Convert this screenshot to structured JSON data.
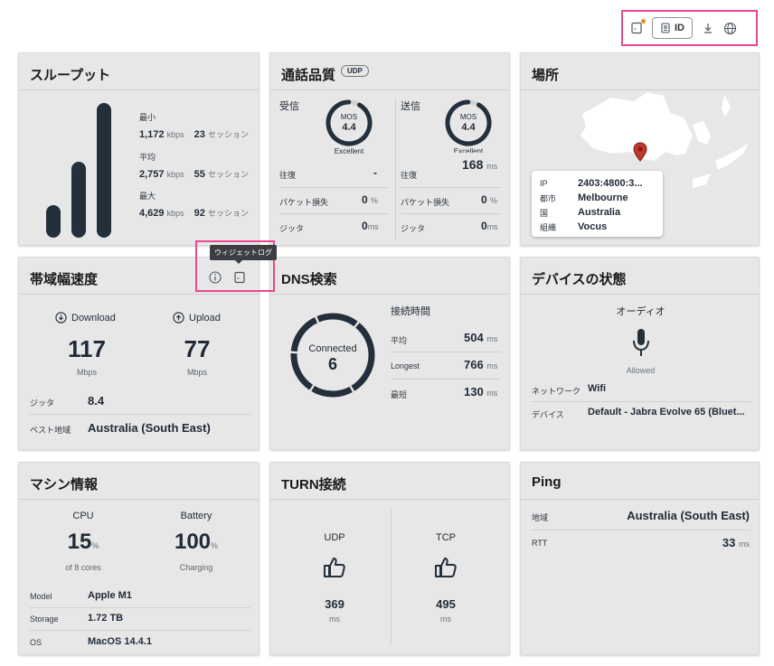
{
  "toolbar": {
    "id_label": "ID"
  },
  "throughput": {
    "title": "スループット",
    "bars": [
      0.23,
      0.53,
      0.94
    ],
    "rows": [
      {
        "label": "最小",
        "value": "1,172",
        "unit": "kbps",
        "sessions": "23",
        "sessions_unit": "セッション"
      },
      {
        "label": "平均",
        "value": "2,757",
        "unit": "kbps",
        "sessions": "55",
        "sessions_unit": "セッション"
      },
      {
        "label": "最大",
        "value": "4,629",
        "unit": "kbps",
        "sessions": "92",
        "sessions_unit": "セッション"
      }
    ]
  },
  "call_quality": {
    "title": "通話品質",
    "badge": "UDP",
    "receive": {
      "label": "受信",
      "mos_label": "MOS",
      "mos": "4.4",
      "rating": "Excellent",
      "return_label": "往復",
      "return_value": "-",
      "loss_label": "パケット損失",
      "loss_value": "0",
      "loss_unit": "%",
      "jitter_label": "ジッタ",
      "jitter_value": "0",
      "jitter_unit": "ms"
    },
    "send": {
      "label": "送信",
      "mos_label": "MOS",
      "mos": "4.4",
      "rating": "Excellent",
      "return_label": "往復",
      "return_value": "168",
      "return_unit": "ms",
      "loss_label": "パケット損失",
      "loss_value": "0",
      "loss_unit": "%",
      "jitter_label": "ジッタ",
      "jitter_value": "0",
      "jitter_unit": "ms"
    }
  },
  "location": {
    "title": "場所",
    "rows": [
      {
        "label": "IP",
        "value": "2403:4800:3..."
      },
      {
        "label": "都市",
        "value": "Melbourne"
      },
      {
        "label": "国",
        "value": "Australia"
      },
      {
        "label": "組織",
        "value": "Vocus"
      }
    ]
  },
  "bandwidth": {
    "title": "帯域幅速度",
    "tooltip": "ウィジェットログ",
    "download_label": "Download",
    "download_value": "117",
    "download_unit": "Mbps",
    "upload_label": "Upload",
    "upload_value": "77",
    "upload_unit": "Mbps",
    "jitter_label": "ジッタ",
    "jitter_value": "8.4",
    "region_label": "ベスト地域",
    "region_value": "Australia (South East)"
  },
  "dns": {
    "title": "DNS検索",
    "status": "Connected",
    "count": "6",
    "conn_time_label": "接続時間",
    "rows": [
      {
        "label": "平均",
        "value": "504",
        "unit": "ms"
      },
      {
        "label": "Longest",
        "value": "766",
        "unit": "ms"
      },
      {
        "label": "最短",
        "value": "130",
        "unit": "ms"
      }
    ]
  },
  "device": {
    "title": "デバイスの状態",
    "audio_label": "オーディオ",
    "audio_status": "Allowed",
    "network_label": "ネットワーク",
    "network_value": "Wifi",
    "device_label": "デバイス",
    "device_value": "Default - Jabra Evolve 65 (Bluet..."
  },
  "machine": {
    "title": "マシン情報",
    "cpu_label": "CPU",
    "cpu_value": "15",
    "cpu_unit": "%",
    "cpu_sub": "of 8 cores",
    "battery_label": "Battery",
    "battery_value": "100",
    "battery_unit": "%",
    "battery_sub": "Charging",
    "rows": [
      {
        "label": "Model",
        "value": "Apple M1"
      },
      {
        "label": "Storage",
        "value": "1.72 TB"
      },
      {
        "label": "OS",
        "value": "MacOS 14.4.1"
      }
    ]
  },
  "turn": {
    "title": "TURN接続",
    "udp_label": "UDP",
    "udp_value": "369",
    "udp_unit": "ms",
    "tcp_label": "TCP",
    "tcp_value": "495",
    "tcp_unit": "ms"
  },
  "ping": {
    "title": "Ping",
    "region_label": "地域",
    "region_value": "Australia (South East)",
    "rtt_label": "RTT",
    "rtt_value": "33",
    "rtt_unit": "ms"
  }
}
